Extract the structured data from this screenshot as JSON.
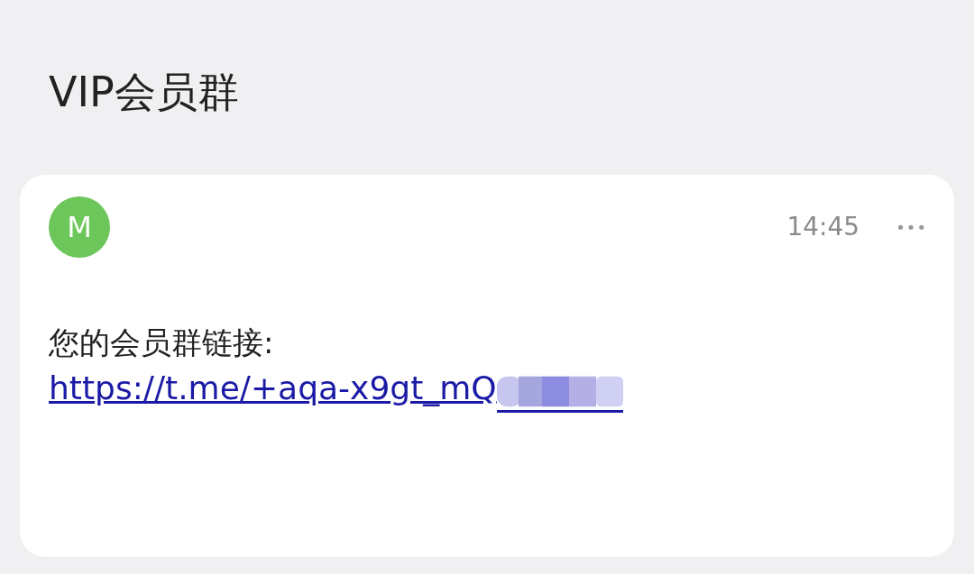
{
  "header": {
    "title": "VIP会员群"
  },
  "message": {
    "avatar_letter": "M",
    "time": "14:45",
    "more": "•••",
    "text": "您的会员群链接:",
    "link": "https://t.me/+aqa-x9gt_mQ"
  }
}
